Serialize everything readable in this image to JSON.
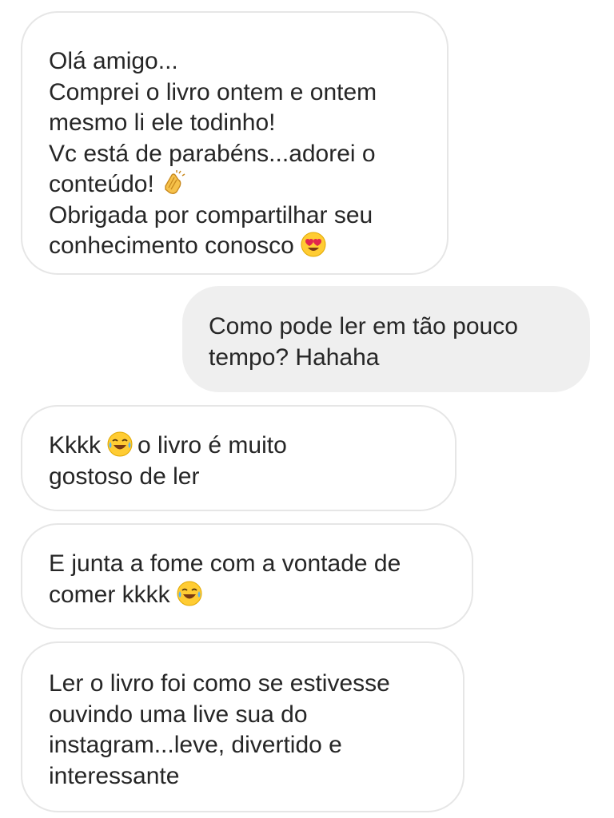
{
  "conversation": {
    "messages": [
      {
        "sender": "other",
        "lines": [
          "Olá amigo...",
          "Comprei o livro ontem e ontem",
          "mesmo li ele todinho!",
          "Vc está de parabéns...adorei o",
          "conteúdo!",
          "Obrigada por compartilhar seu",
          "conhecimento conosco"
        ]
      },
      {
        "sender": "me",
        "lines": [
          "Como pode ler em tão pouco",
          "tempo? Hahaha"
        ]
      },
      {
        "sender": "other",
        "lines": [
          "Kkkk",
          "o livro é muito",
          "gostoso de ler"
        ]
      },
      {
        "sender": "other",
        "lines": [
          "E junta a fome com a vontade de",
          "comer kkkk"
        ]
      },
      {
        "sender": "other",
        "lines": [
          "Ler o livro foi como se estivesse",
          "ouvindo uma live sua do",
          "instagram...leve, divertido e",
          "interessante"
        ]
      }
    ]
  },
  "icons": {
    "clap": "clapping-hands-icon",
    "heart_eyes": "heart-eyes-face-icon",
    "tears_of_joy": "face-with-tears-of-joy-icon"
  },
  "colors": {
    "incoming_bubble_bg": "#ffffff",
    "incoming_bubble_border": "#e6e6e6",
    "outgoing_bubble_bg": "#efefef",
    "text": "#262626"
  }
}
